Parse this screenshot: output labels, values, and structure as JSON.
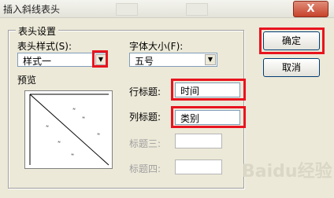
{
  "window": {
    "title": "插入斜线表头",
    "close_label": "X"
  },
  "group": {
    "title": "表头设置",
    "style_label": "表头样式(S):",
    "style_value": "样式一",
    "font_size_label": "字体大小(F):",
    "font_size_value": "五号",
    "preview_label": "预览"
  },
  "fields": {
    "row_title_label": "行标题:",
    "row_title_value": "时间",
    "col_title_label": "列标题:",
    "col_title_value": "类别",
    "title3_label": "标题三:",
    "title3_value": "",
    "title4_label": "标题四:",
    "title4_value": ""
  },
  "buttons": {
    "ok_label": "确定",
    "cancel_label": "取消"
  },
  "watermark": "Baidu经验",
  "highlight_color": "#e8141e"
}
